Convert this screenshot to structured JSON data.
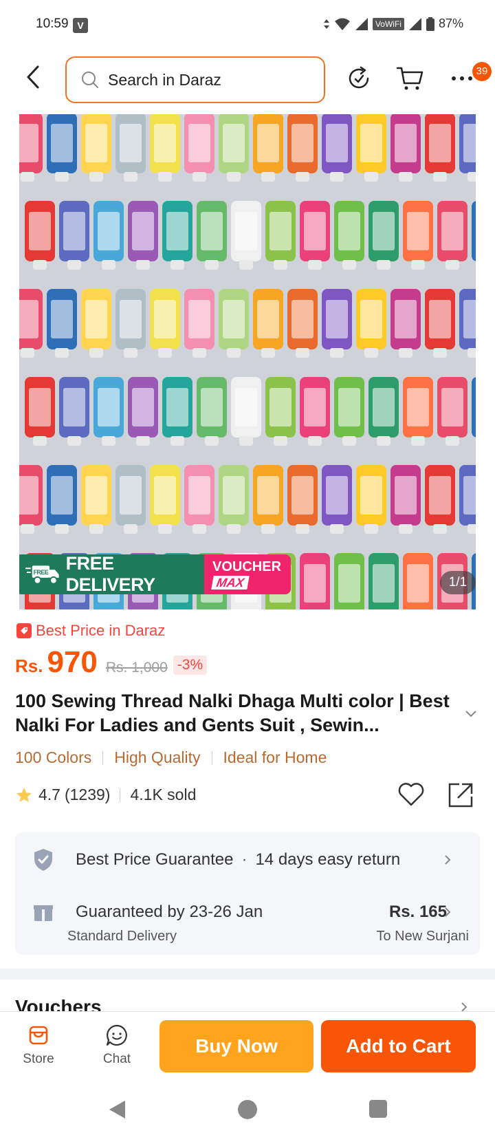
{
  "status_bar": {
    "time": "10:59",
    "carrier_badge": "V",
    "network_label": "VoWiFi",
    "battery": "87%"
  },
  "header": {
    "search_placeholder": "Search in Daraz",
    "cart_badge_count": "39"
  },
  "product_image": {
    "promo_free_delivery": "FREE DELIVERY",
    "promo_free_tag": "FREE",
    "promo_voucher": "VOUCHER",
    "promo_voucher_max": "MAX",
    "image_counter": "1/1"
  },
  "price": {
    "best_price_label": "Best Price in Daraz",
    "currency": "Rs.",
    "current": "970",
    "original": "Rs. 1,000",
    "discount": "-3%"
  },
  "product": {
    "title": "100 Sewing Thread Nalki Dhaga Multi color | Best Nalki For Ladies and Gents Suit , Sewin...",
    "tags": [
      "100 Colors",
      "High Quality",
      "Ideal for Home"
    ],
    "rating": "4.7",
    "rating_count": "(1239)",
    "sold": "4.1K sold"
  },
  "service": {
    "guarantee": "Best Price Guarantee",
    "return_policy": "14 days easy return",
    "delivery_guarantee": "Guaranteed by 23-26 Jan",
    "delivery_price": "Rs. 165",
    "delivery_type": "Standard Delivery",
    "delivery_location": "To New Surjani"
  },
  "sections": {
    "vouchers_title": "Vouchers"
  },
  "action_bar": {
    "store_label": "Store",
    "chat_label": "Chat",
    "buy_now_label": "Buy Now",
    "add_to_cart_label": "Add to Cart"
  },
  "colors": {
    "brand_orange": "#f85606",
    "buy_now": "#ffa41c",
    "tag_brown": "#b86a33",
    "free_delivery_green": "#1f7a5c",
    "voucher_pink": "#f0246b"
  }
}
